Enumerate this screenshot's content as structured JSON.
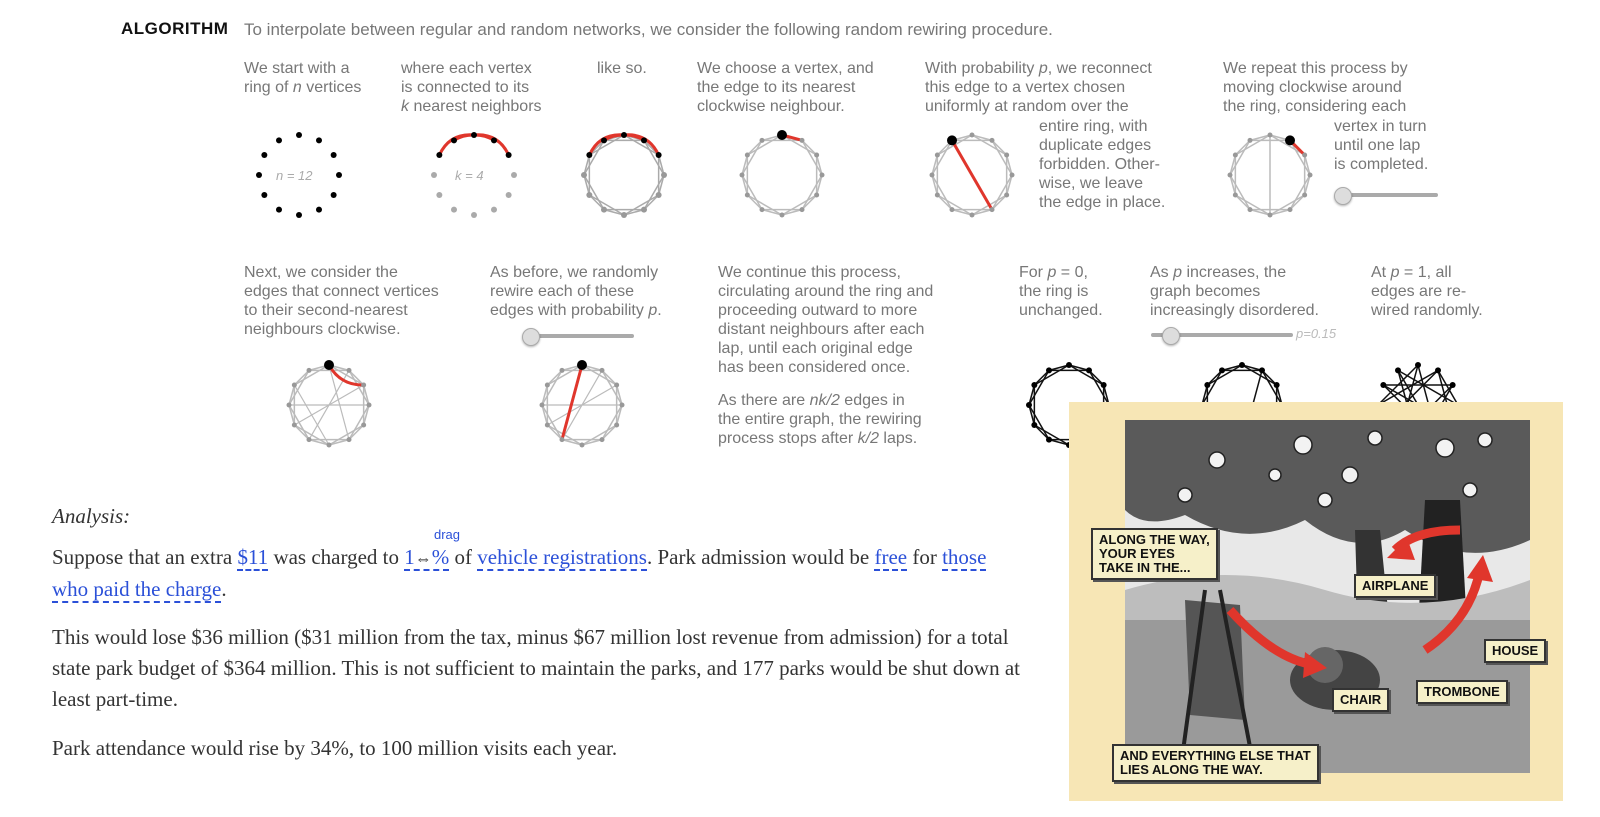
{
  "algorithm": {
    "label": "ALGORITHM",
    "intro": "To interpolate between regular and random networks, we consider the following random rewiring procedure."
  },
  "steps_row1": [
    {
      "caption": "We start with a\nring of n vertices",
      "ring_label": "n = 12"
    },
    {
      "caption": "where each vertex\nis connected to its\nk nearest neighbors",
      "ring_label": "k = 4"
    },
    {
      "caption": "like so."
    },
    {
      "caption": "We choose a vertex, and\nthe edge to its nearest\nclockwise neighbour."
    },
    {
      "caption_top": "With probability p, we reconnect\nthis edge to a vertex chosen\nuniformly at random over the",
      "caption_side": "entire ring, with\nduplicate edges\nforbidden. Other-\nwise, we leave\nthe edge in place."
    },
    {
      "caption_top": "We repeat this process by\nmoving clockwise around\nthe ring, considering each",
      "caption_side": "vertex in turn\nuntil one lap\nis completed."
    }
  ],
  "steps_row2": [
    {
      "caption": "Next, we consider the\nedges that connect vertices\nto their second-nearest\nneighbours clockwise."
    },
    {
      "caption": "As before, we randomly\nrewire each of these\nedges with probability p."
    },
    {
      "caption": "We continue this process,\ncirculating around the ring and\nproceeding outward to more\ndistant neighbours after each\nlap, until each original edge\nhas been considered once.",
      "caption2": "As there are nk/2 edges in\nthe entire graph, the rewiring\nprocess stops after k/2 laps."
    },
    {
      "caption": "For p = 0,\nthe ring is\nunchanged."
    },
    {
      "caption": "As p increases, the\ngraph becomes\nincreasingly disordered.",
      "slider_label": "p=0.15"
    },
    {
      "caption": "At p = 1, all\nedges are re-\nwired randomly."
    }
  ],
  "analysis": {
    "heading": "Analysis:",
    "drag_hint": "drag",
    "p1_a": "Suppose that an extra ",
    "p1_link1": "$11",
    "p1_b": " was charged to ",
    "p1_link2": "1",
    "p1_link2b": "%",
    "p1_c": " of ",
    "p1_link3": "vehicle registrations",
    "p1_d": ". Park admission would be ",
    "p1_link4": "free",
    "p1_e": " for ",
    "p1_link5": "those who paid the charge",
    "p1_f": ".",
    "p2": "This would lose $36 million ($31 million from the tax, minus $67 million lost revenue from admission) for a total state park budget of $364 million. This is not sufficient to maintain the parks, and 177 parks would be shut down at least part-time.",
    "p3": "Park attendance would rise by 34%, to 100 million visits each year."
  },
  "comic": {
    "bubble_top": "ALONG THE WAY,\nYOUR EYES\nTAKE IN THE...",
    "airplane": "AIRPLANE",
    "house": "HOUSE",
    "chair": "CHAIR",
    "trombone": "TROMBONE",
    "bubble_bottom": "AND EVERYTHING ELSE THAT\nLIES ALONG THE WAY."
  },
  "colors": {
    "accent_red": "#e0362c",
    "link_blue": "#2b50d8"
  }
}
